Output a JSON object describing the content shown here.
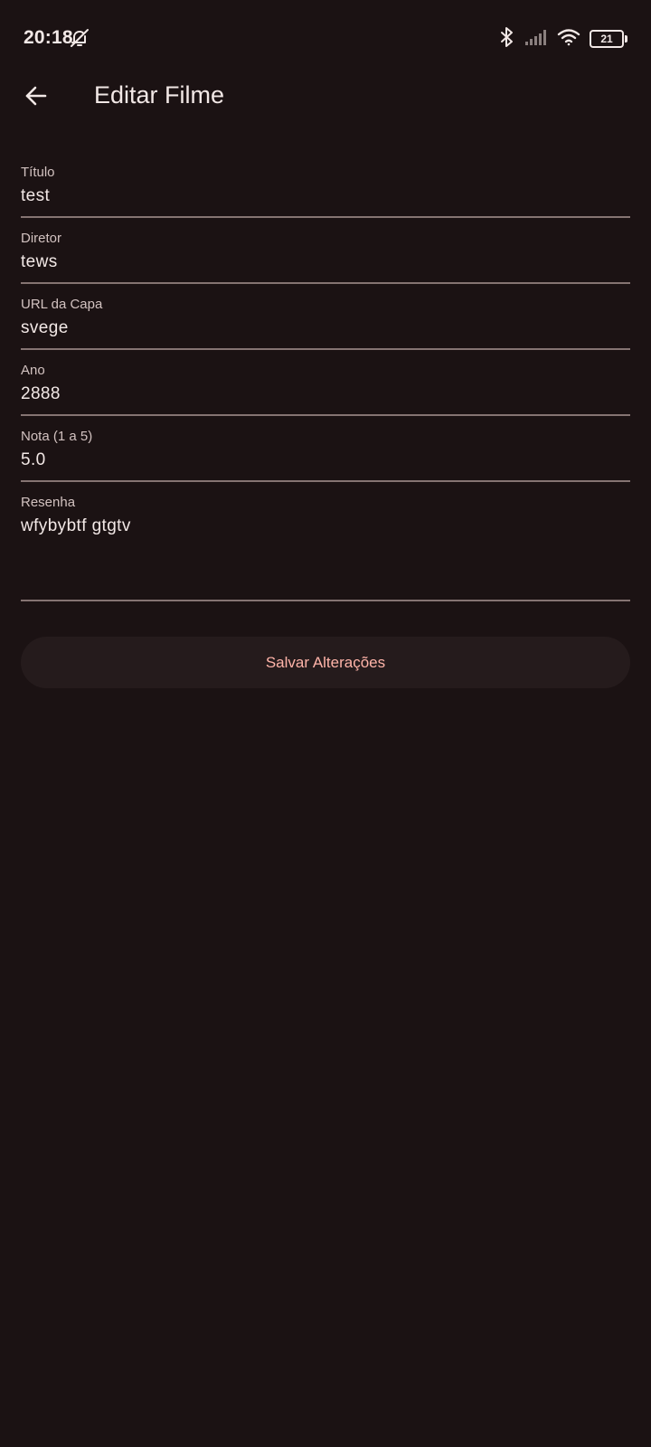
{
  "status_bar": {
    "time": "20:18",
    "battery_level": "21",
    "icons": [
      "bell-off-icon",
      "bluetooth-icon",
      "signal-icon",
      "wifi-icon",
      "battery-icon"
    ]
  },
  "app_bar": {
    "title": "Editar Filme",
    "back_icon": "arrow-left-icon"
  },
  "form": {
    "fields": [
      {
        "label": "Título",
        "value": "test"
      },
      {
        "label": "Diretor",
        "value": "tews"
      },
      {
        "label": "URL da Capa",
        "value": "svege"
      },
      {
        "label": "Ano",
        "value": "2888"
      },
      {
        "label": "Nota (1 a 5)",
        "value": "5.0"
      },
      {
        "label": "Resenha",
        "value": "wfybybtf gtgtv"
      }
    ],
    "save_label": "Salvar Alterações"
  },
  "colors": {
    "background": "#1b1213",
    "text": "#f2e8e6",
    "label": "#d2c2c0",
    "underline": "#857472",
    "button_bg": "#251b1c",
    "accent": "#ffb4a9"
  }
}
